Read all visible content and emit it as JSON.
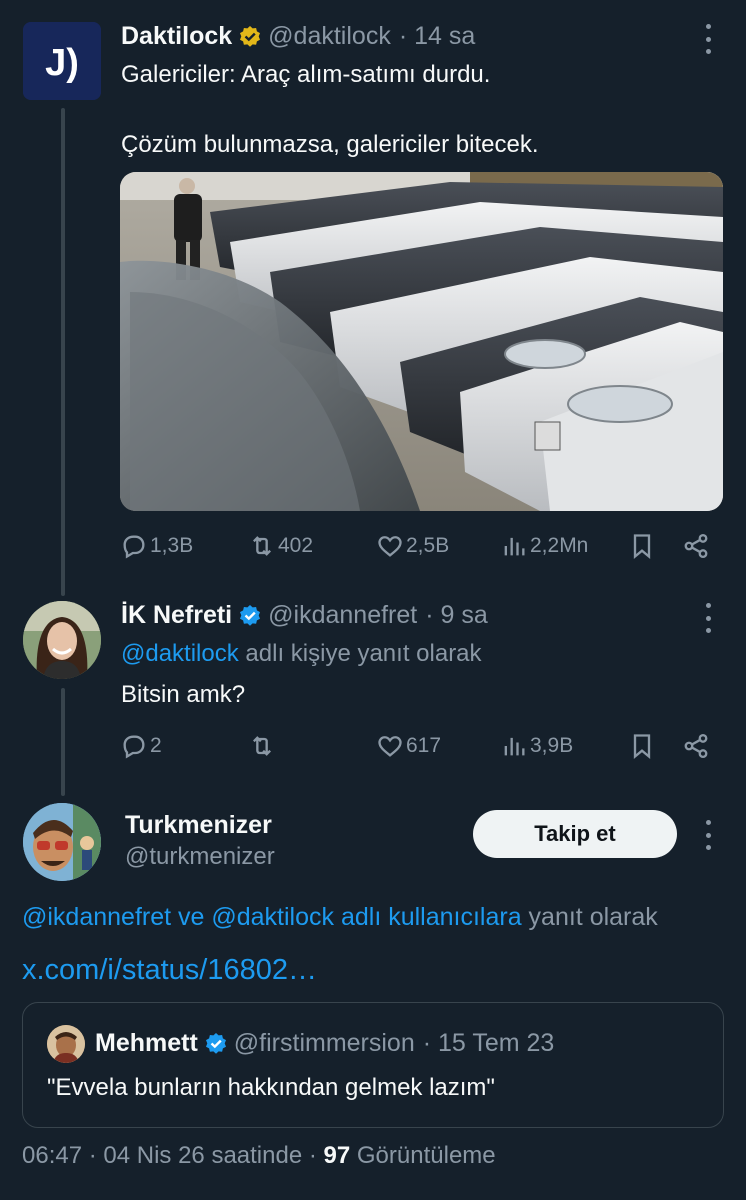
{
  "tweet1": {
    "name": "Daktilock",
    "handle": "@daktilock",
    "time": "· 14 sa",
    "line1": "Galericiler: Araç alım-satımı durdu.",
    "line2": "Çözüm bulunmazsa, galericiler bitecek.",
    "media_icon": "parked-cars-photo",
    "stats": {
      "replies": "1,3B",
      "retweets": "402",
      "likes": "2,5B",
      "views": "2,2Mn"
    }
  },
  "tweet2": {
    "name": "İK Nefreti",
    "handle": "@ikdannefret",
    "time": "· 9 sa",
    "reply_to_handle": "@daktilock",
    "reply_to_suffix": " adlı kişiye yanıt olarak",
    "text": "Bitsin amk?",
    "stats": {
      "replies": "2",
      "likes": "617",
      "views": "3,9B"
    }
  },
  "main_tweet": {
    "name": "Turkmenizer",
    "handle": "@turkmenizer",
    "follow_label": "Takip et",
    "reply_mentions": "@ikdannefret ve @daktilock adlı kullanıcılara",
    "reply_suffix": " yanıt olarak",
    "link_text": "x.com/i/status/16802…",
    "quote": {
      "name": "Mehmett",
      "handle": "@firstimmersion",
      "date": "· 15 Tem 23",
      "text": "\"Evvela bunların hakkından gelmek lazım\""
    },
    "footer": {
      "time": "06:47 · 04 Nis 26 saatinde · ",
      "views_count": "97",
      "views_label": " Görüntüleme"
    }
  },
  "colors": {
    "background": "#15202b",
    "accent": "#1d9bf0",
    "muted": "#8b98a5",
    "verified_badge": "#1d9bf0",
    "gold_badge": "#e2b719"
  }
}
